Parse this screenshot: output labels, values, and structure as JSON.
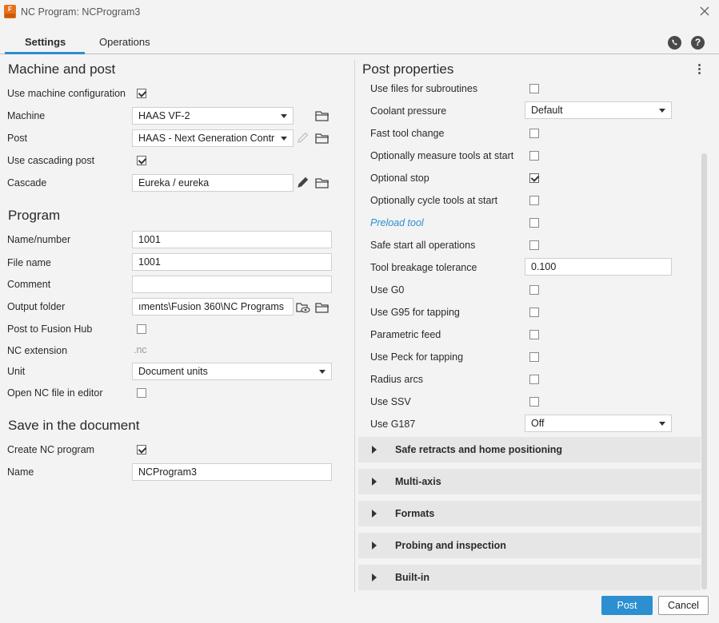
{
  "window": {
    "title": "NC Program: NCProgram3",
    "app_icon_letter": "F"
  },
  "tabs": [
    {
      "label": "Settings",
      "active": true
    },
    {
      "label": "Operations",
      "active": false
    }
  ],
  "machine_and_post": {
    "title": "Machine and post",
    "use_machine_config": {
      "label": "Use machine configuration",
      "checked": true
    },
    "machine": {
      "label": "Machine",
      "value": "HAAS VF-2"
    },
    "post": {
      "label": "Post",
      "value": "HAAS - Next Generation Contr"
    },
    "use_cascading_post": {
      "label": "Use cascading post",
      "checked": true
    },
    "cascade": {
      "label": "Cascade",
      "value": "Eureka / eureka"
    }
  },
  "program": {
    "title": "Program",
    "name_number": {
      "label": "Name/number",
      "value": "1001"
    },
    "file_name": {
      "label": "File name",
      "value": "1001"
    },
    "comment": {
      "label": "Comment",
      "value": ""
    },
    "output_folder": {
      "label": "Output folder",
      "value": "ıments\\Fusion 360\\NC Programs"
    },
    "post_to_hub": {
      "label": "Post to Fusion Hub",
      "checked": false
    },
    "nc_extension": {
      "label": "NC extension",
      "value": ".nc"
    },
    "unit": {
      "label": "Unit",
      "value": "Document units"
    },
    "open_in_editor": {
      "label": "Open NC file in editor",
      "checked": false
    }
  },
  "save_in_document": {
    "title": "Save in the document",
    "create_nc_program": {
      "label": "Create NC program",
      "checked": true
    },
    "name": {
      "label": "Name",
      "value": "NCProgram3"
    }
  },
  "post_properties": {
    "title": "Post properties",
    "rows": [
      {
        "label": "Use files for subroutines",
        "type": "check",
        "checked": false
      },
      {
        "label": "Coolant pressure",
        "type": "select",
        "value": "Default"
      },
      {
        "label": "Fast tool change",
        "type": "check",
        "checked": false
      },
      {
        "label": "Optionally measure tools at start",
        "type": "check",
        "checked": false
      },
      {
        "label": "Optional stop",
        "type": "check",
        "checked": true
      },
      {
        "label": "Optionally cycle tools at start",
        "type": "check",
        "checked": false
      },
      {
        "label": "Preload tool",
        "type": "check",
        "checked": false,
        "link": true
      },
      {
        "label": "Safe start all operations",
        "type": "check",
        "checked": false
      },
      {
        "label": "Tool breakage tolerance",
        "type": "text",
        "value": "0.100"
      },
      {
        "label": "Use G0",
        "type": "check",
        "checked": false
      },
      {
        "label": "Use G95 for tapping",
        "type": "check",
        "checked": false
      },
      {
        "label": "Parametric feed",
        "type": "check",
        "checked": false
      },
      {
        "label": "Use Peck for tapping",
        "type": "check",
        "checked": false
      },
      {
        "label": "Radius arcs",
        "type": "check",
        "checked": false
      },
      {
        "label": "Use SSV",
        "type": "check",
        "checked": false
      },
      {
        "label": "Use G187",
        "type": "select",
        "value": "Off"
      }
    ],
    "groups": [
      "Safe retracts and home positioning",
      "Multi-axis",
      "Formats",
      "Probing and inspection",
      "Built-in"
    ]
  },
  "footer": {
    "post_label": "Post",
    "cancel_label": "Cancel"
  },
  "icons": {
    "folder": "folder-icon",
    "pencil": "pencil-icon",
    "eye_folder": "folder-eye-icon",
    "phone": "phone-icon",
    "help": "help-icon",
    "close": "close-icon"
  },
  "colors": {
    "accent": "#2b8fd0",
    "app_icon": "#e8711c",
    "link": "#2b8fd0"
  }
}
